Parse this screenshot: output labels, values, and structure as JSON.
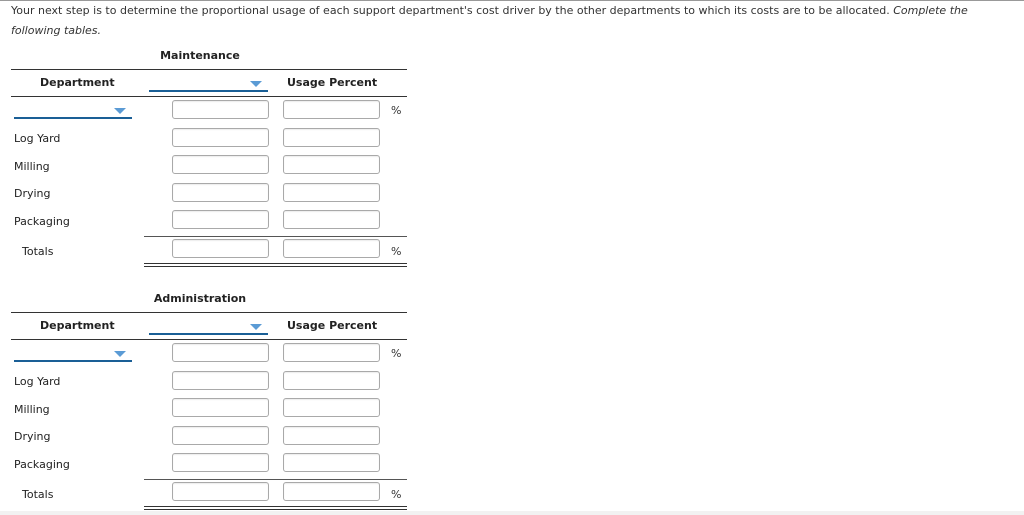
{
  "instructions": {
    "text": "Your next step is to determine the proportional usage of each support department's cost driver by the other departments to which its costs are to be allocated.",
    "emphasis": "Complete the following tables."
  },
  "tables": [
    {
      "title": "Maintenance",
      "header": {
        "department_label": "Department",
        "column1_dropdown_value": "",
        "usage_label": "Usage Percent"
      },
      "first_row": {
        "department_dropdown_value": "",
        "value": "",
        "percent": "",
        "unit": "%"
      },
      "rows": [
        {
          "label": "Log Yard",
          "value": "",
          "percent": ""
        },
        {
          "label": "Milling",
          "value": "",
          "percent": ""
        },
        {
          "label": "Drying",
          "value": "",
          "percent": ""
        },
        {
          "label": "Packaging",
          "value": "",
          "percent": ""
        }
      ],
      "totals": {
        "label": "Totals",
        "value": "",
        "percent": "",
        "unit": "%"
      }
    },
    {
      "title": "Administration",
      "header": {
        "department_label": "Department",
        "column1_dropdown_value": "",
        "usage_label": "Usage Percent"
      },
      "first_row": {
        "department_dropdown_value": "",
        "value": "",
        "percent": "",
        "unit": "%"
      },
      "rows": [
        {
          "label": "Log Yard",
          "value": "",
          "percent": ""
        },
        {
          "label": "Milling",
          "value": "",
          "percent": ""
        },
        {
          "label": "Drying",
          "value": "",
          "percent": ""
        },
        {
          "label": "Packaging",
          "value": "",
          "percent": ""
        }
      ],
      "totals": {
        "label": "Totals",
        "value": "",
        "percent": "",
        "unit": "%"
      }
    }
  ],
  "colors": {
    "dropdown_underline": "#1a5f96",
    "dropdown_arrow": "#5b9bd5"
  }
}
